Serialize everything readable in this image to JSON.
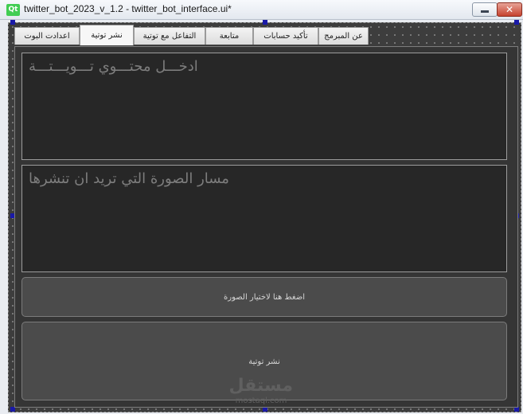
{
  "window": {
    "logo": "Qt",
    "title": "twitter_bot_2023_v_1.2 - twitter_bot_interface.ui*",
    "minimize_icon": "minimize-icon",
    "close_icon": "close-icon",
    "close_glyph": "✕"
  },
  "tabs": [
    {
      "label": "عن المبرمج",
      "active": false
    },
    {
      "label": "تأكيد حسابات",
      "active": false
    },
    {
      "label": "متابعة",
      "active": false
    },
    {
      "label": "التفاعل مع توتية",
      "active": false
    },
    {
      "label": "نشر توتية",
      "active": true
    },
    {
      "label": "اعدادت البوت",
      "active": false
    }
  ],
  "post_tab": {
    "tweet_content_placeholder": "ادخـــل محتـــوي تـــويـــتـــة",
    "image_path_placeholder": "مسار الصورة التي تريد ان تنشرها",
    "choose_image_button": "اضغط هنا لاختيار الصورة",
    "publish_button": "نشر توتية"
  },
  "watermark": {
    "arabic": "مستقل",
    "latin": "mostaql.com"
  },
  "colors": {
    "form_bg": "#3d3d3d",
    "input_bg": "#272727",
    "button_bg": "#4b4b4b",
    "qt_green": "#41cd52"
  }
}
